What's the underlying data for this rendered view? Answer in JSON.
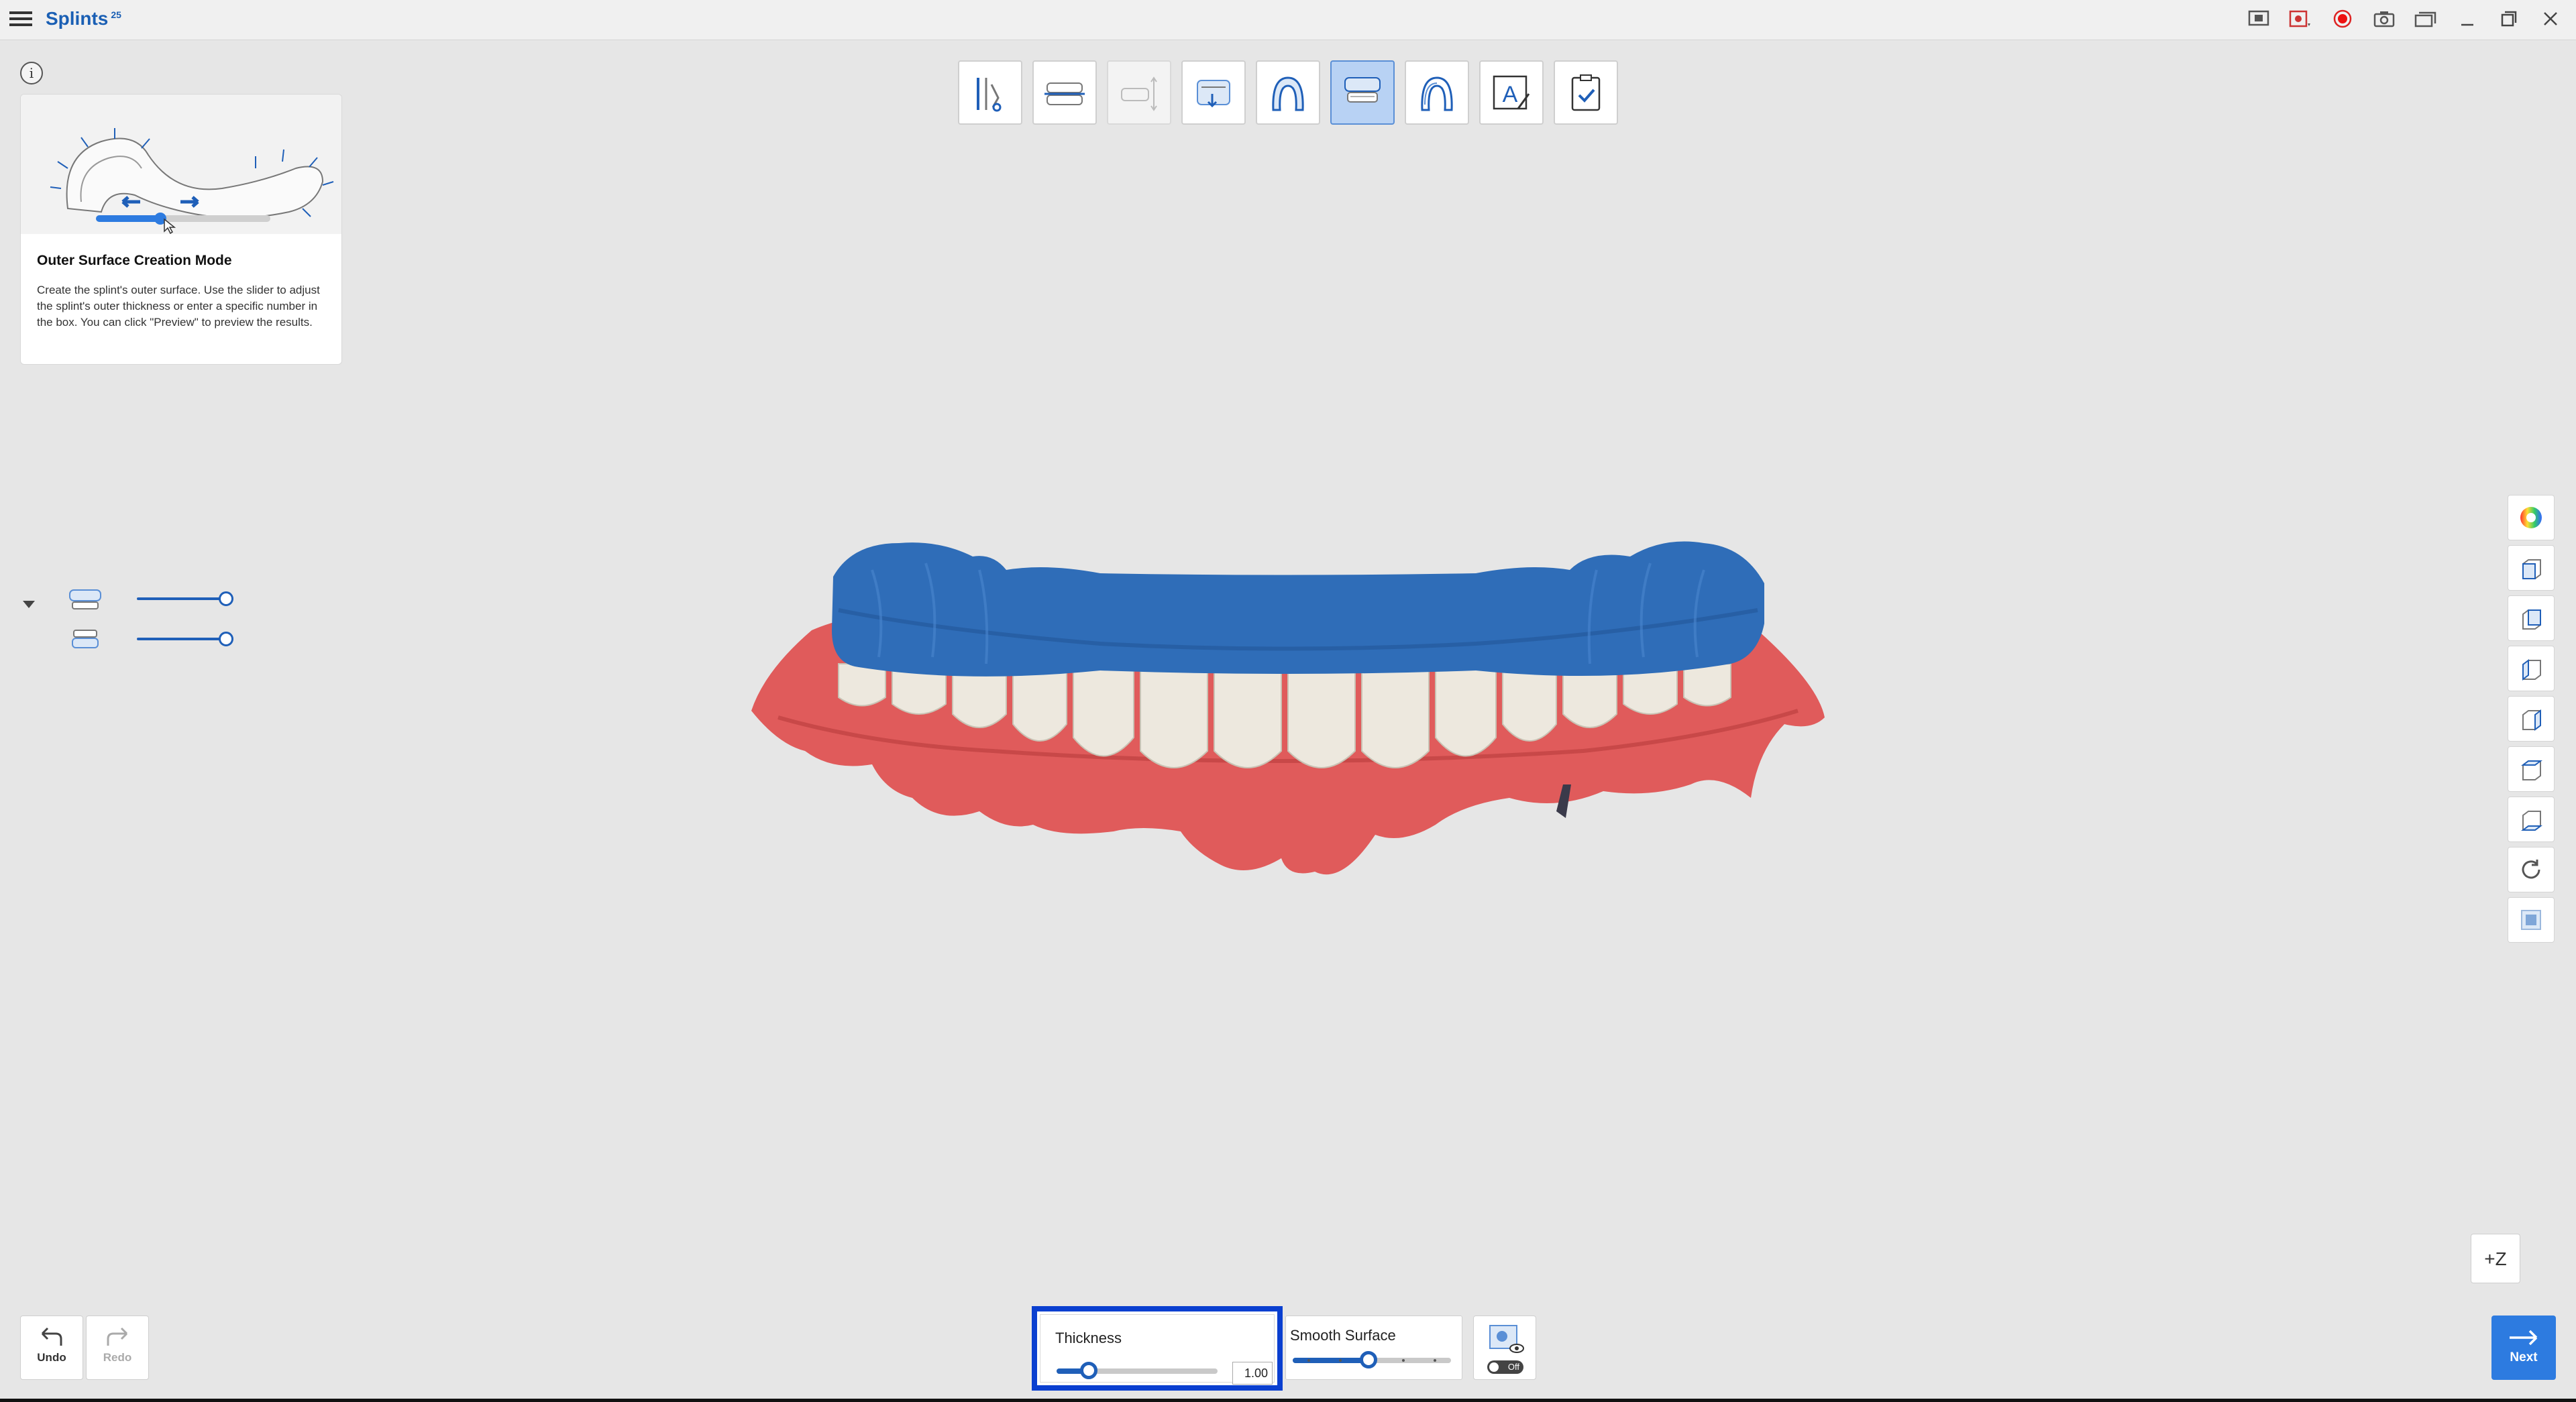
{
  "app": {
    "title": "Splints",
    "title_badge": "25"
  },
  "window_controls": [
    "screen-share-icon",
    "record-menu-icon",
    "record-icon",
    "camera-icon",
    "gallery-icon",
    "minimize-icon",
    "restore-icon",
    "close-icon"
  ],
  "guide": {
    "info_symbol": "i",
    "title": "Outer Surface Creation Mode",
    "text": "Create the splint's outer surface. Use the slider to adjust the splint's outer thickness or enter a specific number in the box. You can click \"Preview\" to preview the results."
  },
  "stages": [
    {
      "icon": "align-tools-icon",
      "state": "normal"
    },
    {
      "icon": "occlusal-plane-icon",
      "state": "normal"
    },
    {
      "icon": "insertion-direction-icon",
      "state": "disabled"
    },
    {
      "icon": "block-out-icon",
      "state": "normal"
    },
    {
      "icon": "margin-line-icon",
      "state": "normal"
    },
    {
      "icon": "outer-surface-icon",
      "state": "active"
    },
    {
      "icon": "splint-shape-icon",
      "state": "normal"
    },
    {
      "icon": "text-label-icon",
      "state": "normal"
    },
    {
      "icon": "checklist-icon",
      "state": "normal"
    }
  ],
  "visibility": {
    "rows": [
      {
        "icon": "upper-jaw-icon",
        "opacity": 1.0
      },
      {
        "icon": "lower-jaw-icon",
        "opacity": 1.0
      }
    ]
  },
  "view_toolbar": [
    "color-wheel-icon",
    "front-view-icon",
    "back-view-icon",
    "left-view-icon",
    "right-view-icon",
    "top-view-icon",
    "bottom-view-icon",
    "reset-view-icon",
    "model-display-icon"
  ],
  "axis_label": "+Z",
  "history": {
    "undo_label": "Undo",
    "redo_label": "Redo"
  },
  "thickness": {
    "label": "Thickness",
    "value": "1.00",
    "slider_fraction": 0.2
  },
  "smooth": {
    "label": "Smooth Surface",
    "slider_fraction": 0.48,
    "steps": 5
  },
  "preview": {
    "toggle_label": "Off"
  },
  "next_label": "Next",
  "colors": {
    "accent": "#1f5fb8",
    "highlight": "#0a3fd0",
    "splint": "#2f6db8",
    "gum": "#e05b5b",
    "teeth": "#ede8de"
  }
}
